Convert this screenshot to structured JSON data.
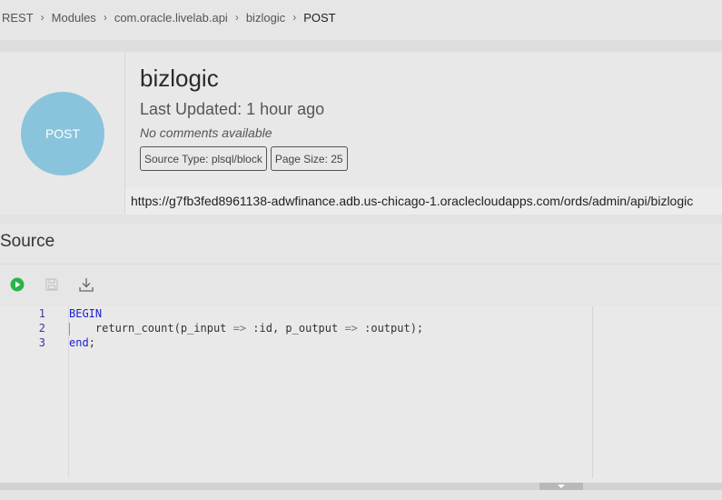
{
  "breadcrumb": {
    "items": [
      "REST",
      "Modules",
      "com.oracle.livelab.api",
      "bizlogic",
      "POST"
    ]
  },
  "handler": {
    "method": "POST",
    "name": "bizlogic",
    "last_updated": "Last Updated: 1 hour ago",
    "comments": "No comments available",
    "source_type": "Source Type: plsql/block",
    "page_size": "Page Size: 25",
    "url": "https://g7fb3fed8961138-adwfinance.adb.us-chicago-1.oraclecloudapps.com/ords/admin/api/bizlogic"
  },
  "source": {
    "heading": "Source",
    "toolbar_icons": [
      "run-icon",
      "save-icon",
      "download-icon"
    ],
    "line_numbers": [
      "1",
      "2",
      "3"
    ],
    "lines": {
      "l1_kw": "BEGIN",
      "l2_indent": "    ",
      "l2_a": "return_count(p_input ",
      "l2_op1": "=>",
      "l2_b": " :id, p_output ",
      "l2_op2": "=>",
      "l2_c": " :output);",
      "l3_kw": "end",
      "l3_rest": ";"
    }
  },
  "colors": {
    "method_circle": "#89c4dc",
    "run_button": "#2bb34a",
    "keyword": "#1c1cd0"
  }
}
